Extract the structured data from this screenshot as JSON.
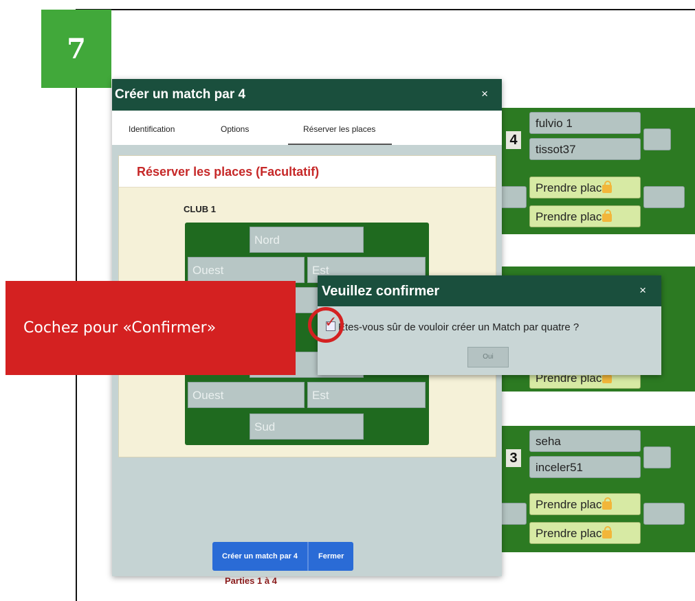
{
  "step_number": "7",
  "background": {
    "top_partial_text": "",
    "bottom_partial_text": "Parties 1 à 4",
    "table1": {
      "table_number": "4",
      "players": [
        "fulvio 1",
        "tissot37"
      ],
      "take_seat": [
        "Prendre plac",
        "Prendre plac"
      ]
    },
    "table2": {
      "take_seat": [
        "Prendre plac"
      ]
    },
    "table3": {
      "table_number": "3",
      "players": [
        "seha",
        "inceler51"
      ],
      "take_seat": [
        "Prendre plac",
        "Prendre plac"
      ]
    }
  },
  "dialog": {
    "title": "Créer un match par 4",
    "close_glyph": "×",
    "tabs": [
      "Identification",
      "Options",
      "Réserver les places"
    ],
    "active_tab": "Réserver les places",
    "panel_title": "Réserver les places (Facultatif)",
    "club_label": "CLUB 1",
    "seats": {
      "north_1": "Nord",
      "west_1": "Ouest",
      "east_1": "Est",
      "west_2": "Ouest",
      "east_2": "Est",
      "south_2": "Sud"
    },
    "buttons": {
      "create": "Créer un match par 4",
      "close": "Fermer"
    }
  },
  "confirm": {
    "title": "Veuillez confirmer",
    "close_glyph": "×",
    "question": "Êtes-vous sûr de vouloir créer un Match par quatre ?",
    "check_mark": "✓",
    "yes_button": "Oui"
  },
  "annotation": {
    "callout_text": "Cochez pour «Confirmer»"
  },
  "colors": {
    "header_green": "#1a4f3d",
    "table_green": "#1f6a1f",
    "step_badge": "#41a83a",
    "callout_red": "#d42121",
    "button_blue": "#2a6bd6",
    "panel_title_red": "#c62828"
  }
}
